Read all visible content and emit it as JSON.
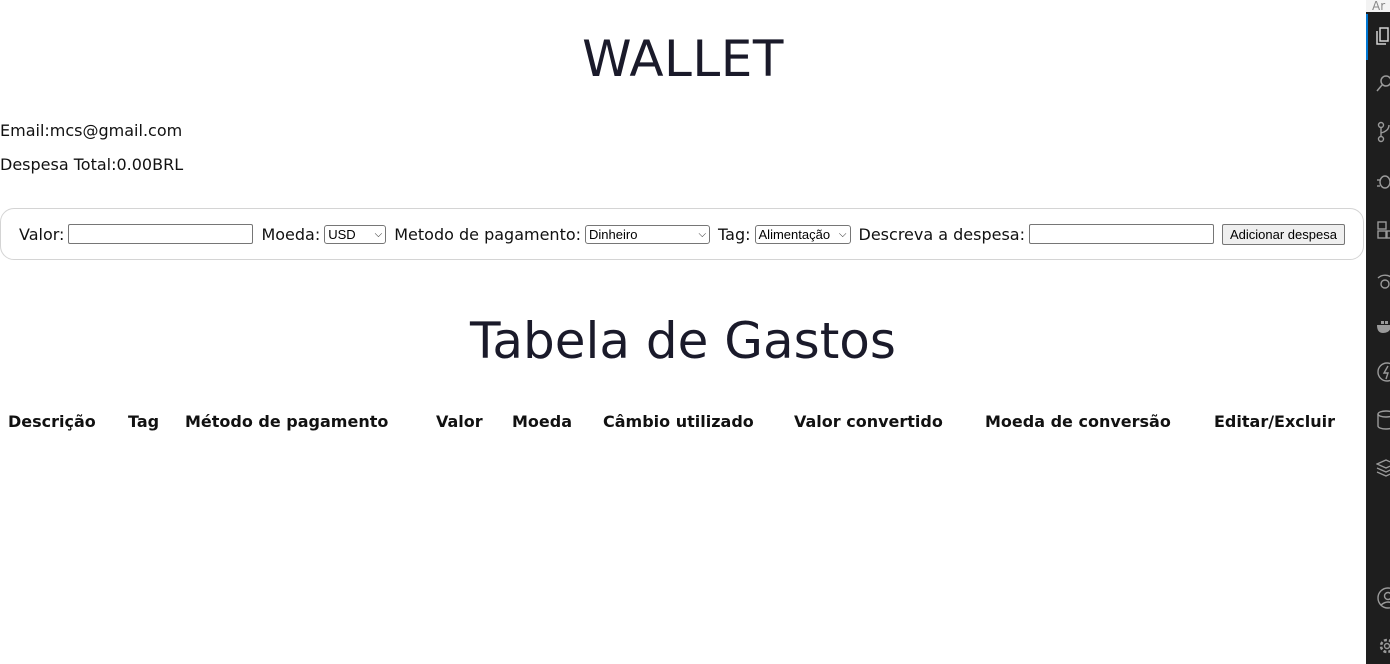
{
  "header": {
    "title": "WALLET",
    "email_label": "Email:",
    "email_value": "mcs@gmail.com",
    "total_label": "Despesa Total:",
    "total_value": "0.00",
    "total_currency": "BRL"
  },
  "form": {
    "valor_label": "Valor:",
    "valor_value": "",
    "moeda_label": "Moeda:",
    "moeda_selected": "USD",
    "metodo_label": "Metodo de pagamento:",
    "metodo_selected": "Dinheiro",
    "tag_label": "Tag:",
    "tag_selected": "Alimentação",
    "descricao_label": "Descreva a despesa:",
    "descricao_value": "",
    "add_button": "Adicionar despesa"
  },
  "table": {
    "title": "Tabela de Gastos",
    "headers": [
      "Descrição",
      "Tag",
      "Método de pagamento",
      "Valor",
      "Moeda",
      "Câmbio utilizado",
      "Valor convertido",
      "Moeda de conversão",
      "Editar/Excluir"
    ],
    "rows": []
  },
  "editor_sidebar": {
    "top_text": "Ar",
    "icons": [
      "explorer-icon",
      "search-icon",
      "source-control-icon",
      "debug-icon",
      "extensions-icon",
      "remote-explorer-icon",
      "docker-icon",
      "lightning-icon",
      "database-icon",
      "layers-icon",
      "account-icon",
      "settings-gear-icon"
    ],
    "accent": "#0078d4"
  }
}
